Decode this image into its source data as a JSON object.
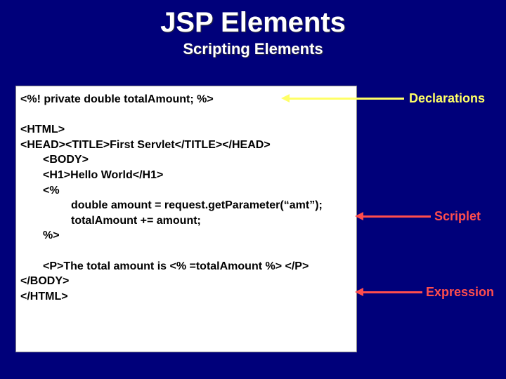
{
  "title": "JSP Elements",
  "subtitle": "Scripting Elements",
  "code": {
    "decl": "<%! private double totalAmount; %>",
    "blank1": " ",
    "htmlOpen": "<HTML>",
    "head": "<HEAD><TITLE>First Servlet</TITLE></HEAD>",
    "bodyOpen": "<BODY>",
    "h1": "<H1>Hello World</H1>",
    "scOpen": "<%",
    "amountLine": "double amount = request.getParameter(“amt”);",
    "totalLine": "totalAmount += amount;",
    "scClose": "%>",
    "blank2": " ",
    "expr": "<P>The total amount is <% =totalAmount %> </P>",
    "bodyClose": "</BODY>",
    "htmlClose": "</HTML>"
  },
  "labels": {
    "declarations": "Declarations",
    "scriplet": "Scriplet",
    "expression": "Expression"
  }
}
